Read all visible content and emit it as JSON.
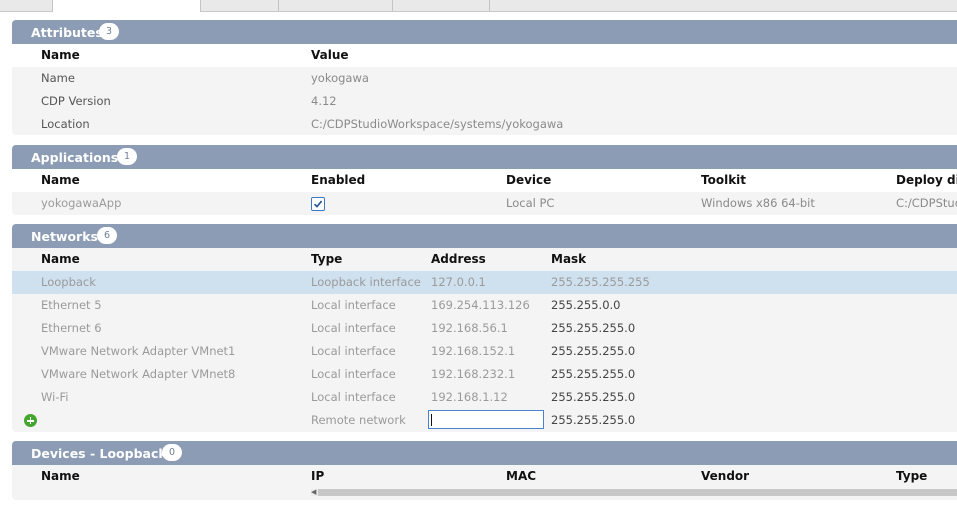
{
  "attributes": {
    "title": "Attributes",
    "count": "3",
    "headers": {
      "name": "Name",
      "value": "Value"
    },
    "rows": [
      {
        "name": "Name",
        "value": "yokogawa"
      },
      {
        "name": "CDP Version",
        "value": "4.12"
      },
      {
        "name": "Location",
        "value": "C:/CDPStudioWorkspace/systems/yokogawa"
      }
    ]
  },
  "applications": {
    "title": "Applications",
    "count": "1",
    "headers": {
      "name": "Name",
      "enabled": "Enabled",
      "device": "Device",
      "toolkit": "Toolkit",
      "deploy": "Deploy di"
    },
    "rows": [
      {
        "name": "yokogawaApp",
        "enabled": true,
        "device": "Local PC",
        "toolkit": "Windows x86 64-bit",
        "deploy": "C:/CDPStud"
      }
    ]
  },
  "networks": {
    "title": "Networks",
    "count": "6",
    "headers": {
      "name": "Name",
      "type": "Type",
      "address": "Address",
      "mask": "Mask"
    },
    "rows": [
      {
        "name": "Loopback",
        "type": "Loopback interface",
        "address": "127.0.0.1",
        "mask": "255.255.255.255"
      },
      {
        "name": "Ethernet 5",
        "type": "Local interface",
        "address": "169.254.113.126",
        "mask": "255.255.0.0"
      },
      {
        "name": "Ethernet 6",
        "type": "Local interface",
        "address": "192.168.56.1",
        "mask": "255.255.255.0"
      },
      {
        "name": "VMware Network Adapter VMnet1",
        "type": "Local interface",
        "address": "192.168.152.1",
        "mask": "255.255.255.0"
      },
      {
        "name": "VMware Network Adapter VMnet8",
        "type": "Local interface",
        "address": "192.168.232.1",
        "mask": "255.255.255.0"
      },
      {
        "name": "Wi-Fi",
        "type": "Local interface",
        "address": "192.168.1.12",
        "mask": "255.255.255.0"
      }
    ],
    "new_row": {
      "type": "Remote network",
      "address": "",
      "mask": "255.255.255.0"
    },
    "selected": "Loopback"
  },
  "devices": {
    "title": "Devices - Loopback",
    "count": "0",
    "headers": {
      "name": "Name",
      "ip": "IP",
      "mac": "MAC",
      "vendor": "Vendor",
      "type": "Type"
    }
  },
  "colors": {
    "header_bar": "#8b9cb4",
    "selected_row": "#cfe0ef",
    "add_icon": "#46a530",
    "focus": "#4a83c9"
  }
}
